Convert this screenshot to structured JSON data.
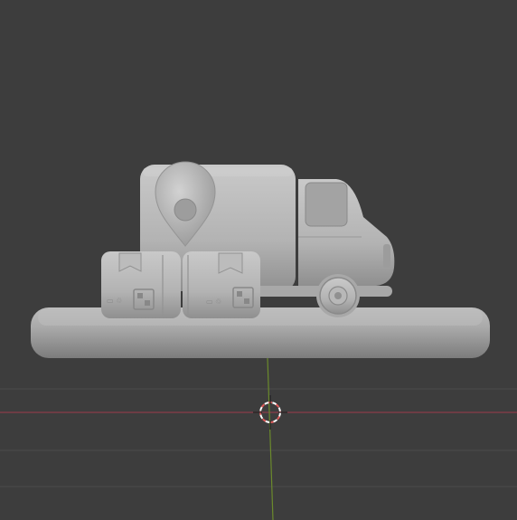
{
  "viewport": {
    "background": "#3d3d3d",
    "grid_color": "#4a4a4a",
    "x_axis_color": "#8a3d48",
    "y_axis_color": "#6b8a2c",
    "clay_color": "#b4b4b4"
  },
  "scene": {
    "objects": [
      "delivery-truck",
      "map-pin-marker",
      "cardboard-box",
      "cardboard-box",
      "base-platform"
    ]
  },
  "cursor_3d": {
    "icon": "3d-cursor-icon",
    "ring_colors": [
      "#e05a5a",
      "#ffffff"
    ]
  }
}
